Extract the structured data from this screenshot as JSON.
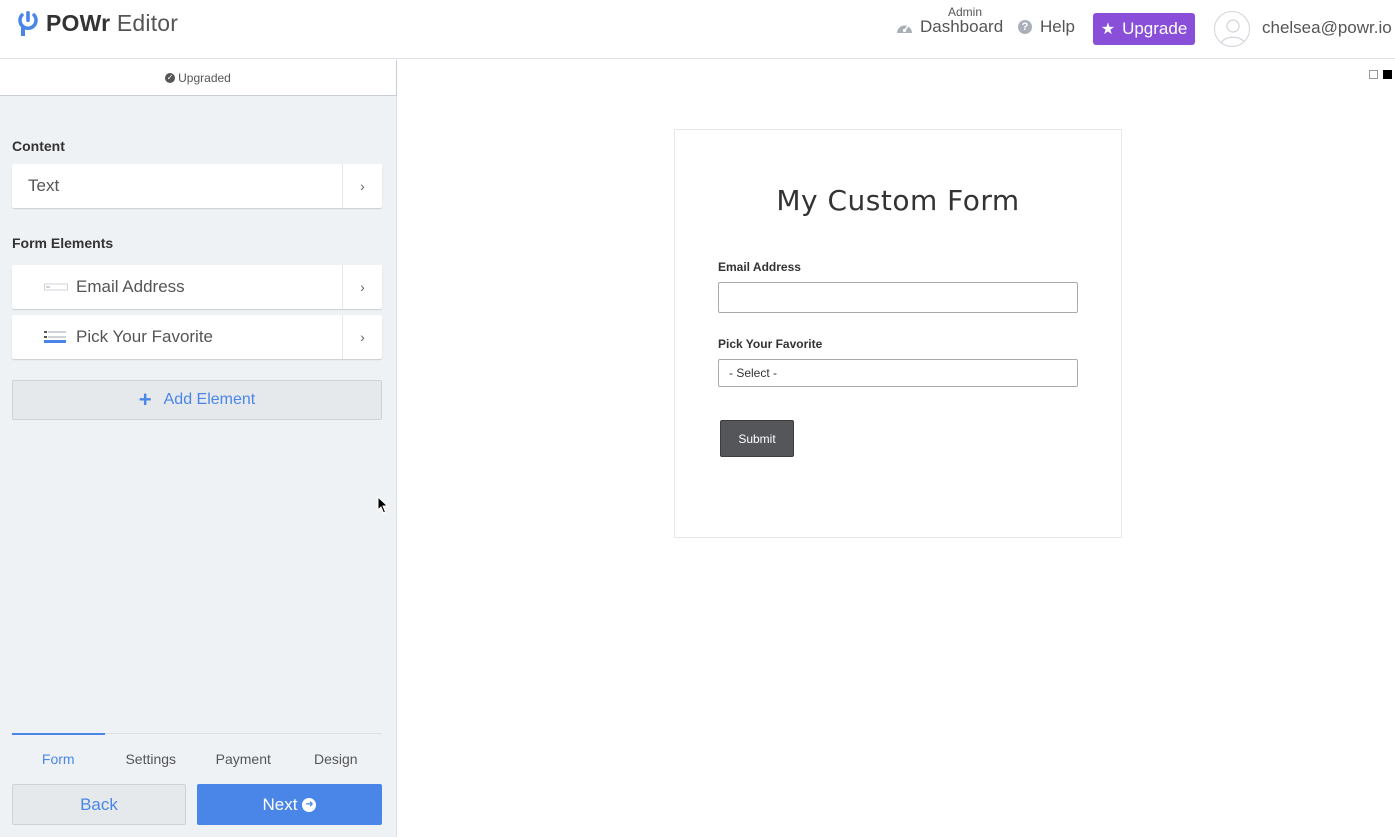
{
  "header": {
    "logo_brand": "POWr",
    "logo_product": "Editor",
    "admin_label": "Admin",
    "dashboard_label": "Dashboard",
    "help_label": "Help",
    "upgrade_label": "Upgrade",
    "user_email": "chelsea@powr.io",
    "upgrade_color": "#8a4fd9"
  },
  "sidebar": {
    "status": "Upgraded",
    "content_section": "Content",
    "content_items": [
      {
        "label": "Text"
      }
    ],
    "form_section": "Form Elements",
    "form_items": [
      {
        "label": "Email Address",
        "icon": "text-field-icon"
      },
      {
        "label": "Pick Your Favorite",
        "icon": "dropdown-field-icon"
      }
    ],
    "add_element": "Add Element",
    "tabs": [
      {
        "label": "Form",
        "active": true
      },
      {
        "label": "Settings",
        "active": false
      },
      {
        "label": "Payment",
        "active": false
      },
      {
        "label": "Design",
        "active": false
      }
    ],
    "back_label": "Back",
    "next_label": "Next",
    "accent_color": "#4a86e8"
  },
  "preview": {
    "title": "My Custom Form",
    "fields": [
      {
        "label": "Email Address",
        "type": "text",
        "value": ""
      },
      {
        "label": "Pick Your Favorite",
        "type": "select",
        "value": "- Select -"
      }
    ],
    "submit_label": "Submit"
  }
}
